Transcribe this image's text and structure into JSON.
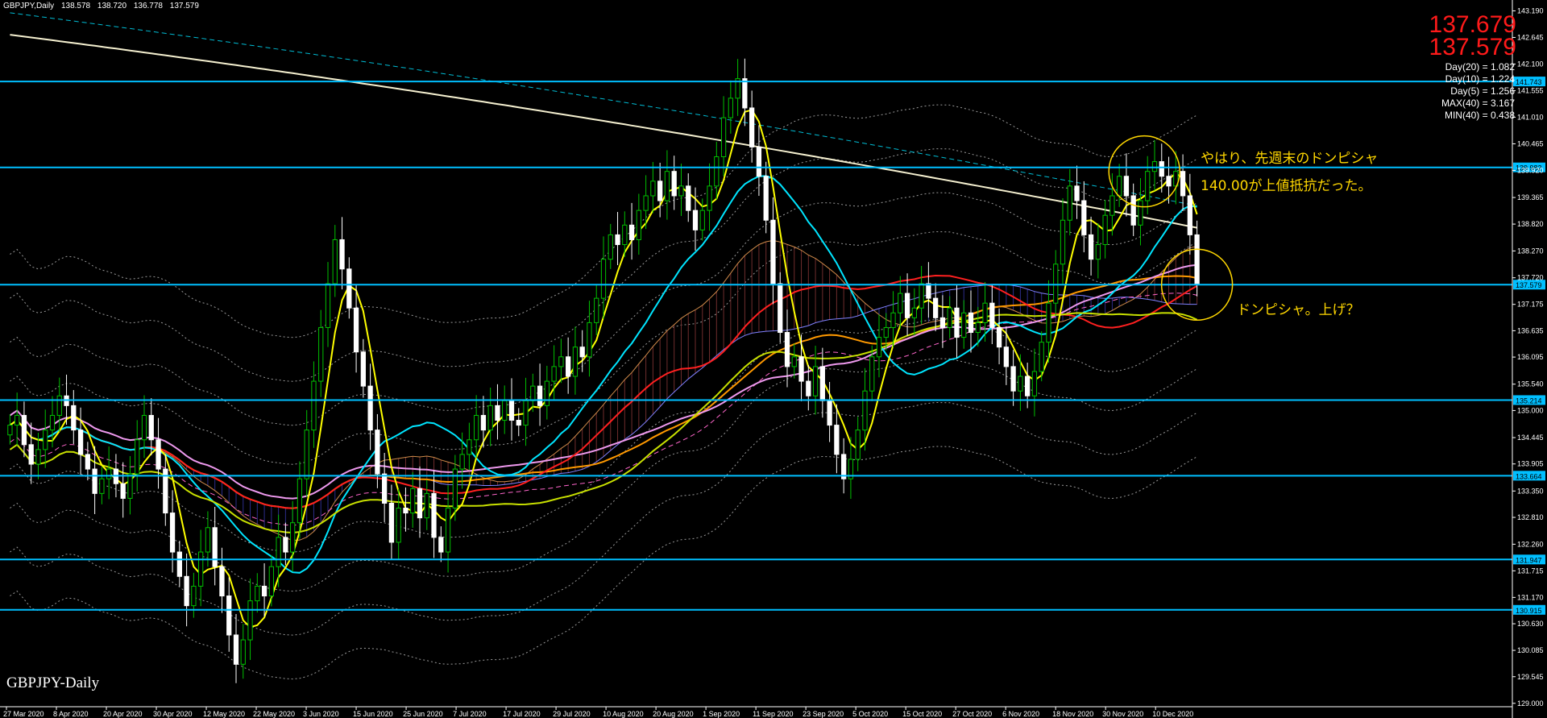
{
  "header": {
    "symbol": "GBPJPY,Daily",
    "ohlc": [
      "138.578",
      "138.720",
      "136.778",
      "137.579"
    ]
  },
  "price_ask": "137.679",
  "price_bid": "137.579",
  "stats": [
    "Day(20) = 1.082",
    "Day(10) = 1.224",
    "Day(5) = 1.256",
    "MAX(40) = 3.167",
    "MIN(40) = 0.438"
  ],
  "annotations": {
    "line1": "やはり、先週末のドンピシャ",
    "line2": "140.00が上値抵抗だった。",
    "line3": "ドンピシャ。上げ？"
  },
  "watermark": "GBPJPY-Daily",
  "colors": {
    "background": "#000000",
    "hline": "#00bfff",
    "bull": "#00c000",
    "bear": "#ffffff",
    "price_text": "#ff1a1a",
    "annotation": "#ffd700"
  },
  "chart_data": {
    "type": "candlestick",
    "x_labels": [
      "27 Mar 2020",
      "8 Apr 2020",
      "20 Apr 2020",
      "30 Apr 2020",
      "12 May 2020",
      "22 May 2020",
      "3 Jun 2020",
      "15 Jun 2020",
      "25 Jun 2020",
      "7 Jul 2020",
      "17 Jul 2020",
      "29 Jul 2020",
      "10 Aug 2020",
      "20 Aug 2020",
      "1 Sep 2020",
      "11 Sep 2020",
      "23 Sep 2020",
      "5 Oct 2020",
      "15 Oct 2020",
      "27 Oct 2020",
      "6 Nov 2020",
      "18 Nov 2020",
      "30 Nov 2020",
      "10 Dec 2020"
    ],
    "y_ticks": [
      "143.190",
      "142.645",
      "142.100",
      "141.555",
      "141.010",
      "140.465",
      "139.920",
      "139.365",
      "138.820",
      "138.270",
      "137.720",
      "137.175",
      "136.635",
      "136.095",
      "135.540",
      "135.000",
      "134.445",
      "133.905",
      "133.350",
      "132.810",
      "132.260",
      "131.715",
      "131.170",
      "130.630",
      "130.085",
      "129.545",
      "129.000"
    ],
    "ylim": [
      128.93,
      143.28
    ],
    "grid": false,
    "horizontal_lines": [
      {
        "price": 141.743,
        "label": "141.743"
      },
      {
        "price": 139.982,
        "label": "139.982"
      },
      {
        "price": 137.579,
        "label": "137.579"
      },
      {
        "price": 135.214,
        "label": "135.214"
      },
      {
        "price": 133.664,
        "label": "133.664"
      },
      {
        "price": 131.947,
        "label": "131.947"
      },
      {
        "price": 130.915,
        "label": "130.915"
      }
    ],
    "closes": [
      134.7,
      134.9,
      134.3,
      133.9,
      134.2,
      134.6,
      134.9,
      135.3,
      135.1,
      134.6,
      134.1,
      133.8,
      133.3,
      133.6,
      133.8,
      133.5,
      133.2,
      133.7,
      134.4,
      134.9,
      134.4,
      133.8,
      132.9,
      132.1,
      131.6,
      131.0,
      131.4,
      132.1,
      132.6,
      131.8,
      131.2,
      130.4,
      129.8,
      130.3,
      131.1,
      131.4,
      131.2,
      131.8,
      132.4,
      132.1,
      132.7,
      133.6,
      134.6,
      135.6,
      136.7,
      137.6,
      138.5,
      137.9,
      137.1,
      136.2,
      135.5,
      134.6,
      133.7,
      133.1,
      132.3,
      133.0,
      132.9,
      133.4,
      132.8,
      133.3,
      132.4,
      132.1,
      133.0,
      133.8,
      134.1,
      134.4,
      134.9,
      134.6,
      135.1,
      134.8,
      135.2,
      134.8,
      134.7,
      135.2,
      135.5,
      135.1,
      135.6,
      135.9,
      136.1,
      135.7,
      136.3,
      136.1,
      136.8,
      137.3,
      138.1,
      138.6,
      138.4,
      138.8,
      138.5,
      139.1,
      139.4,
      139.7,
      139.3,
      139.9,
      139.4,
      139.6,
      139.1,
      138.7,
      139.1,
      139.6,
      140.2,
      141.0,
      141.4,
      141.8,
      141.2,
      140.4,
      139.8,
      138.9,
      137.6,
      136.6,
      135.9,
      136.1,
      135.6,
      135.3,
      135.9,
      135.2,
      134.7,
      134.1,
      133.6,
      134.0,
      134.6,
      135.4,
      136.1,
      136.5,
      136.7,
      137.0,
      137.4,
      136.9,
      137.1,
      137.6,
      137.3,
      136.9,
      136.7,
      137.1,
      136.5,
      137.0,
      136.6,
      136.8,
      137.2,
      136.7,
      136.3,
      135.9,
      135.4,
      135.7,
      135.3,
      135.8,
      136.4,
      137.2,
      138.0,
      138.9,
      139.6,
      139.3,
      138.6,
      138.1,
      138.4,
      139.0,
      139.4,
      139.8,
      139.4,
      138.8,
      139.3,
      139.9,
      140.1,
      139.8,
      139.6,
      139.9,
      139.4,
      138.6,
      137.6
    ],
    "marker_circles": [
      {
        "date": "30 Nov 2020",
        "price": 139.9,
        "label": "やはり、先週末のドンピシャ"
      },
      {
        "date": "10 Dec 2020",
        "price": 137.579,
        "label": "ドンピシャ。上げ？"
      }
    ]
  }
}
